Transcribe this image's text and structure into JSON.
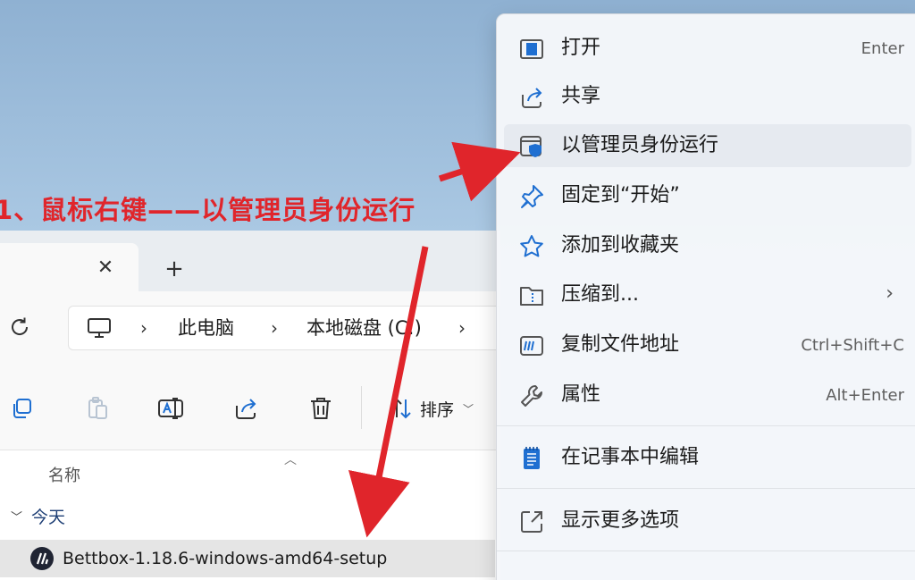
{
  "explorer": {
    "tab_close": "✕",
    "new_tab": "+",
    "breadcrumb": [
      "此电脑",
      "本地磁盘 (C:)"
    ],
    "toolbar": {
      "sort_label": "排序"
    },
    "file_list": {
      "column_name": "名称",
      "group": "今天",
      "file": "Bettbox-1.18.6-windows-amd64-setup"
    }
  },
  "context_menu": {
    "items": [
      {
        "label": "打开",
        "shortcut": "Enter"
      },
      {
        "label": "共享",
        "shortcut": ""
      },
      {
        "label": "以管理员身份运行",
        "shortcut": ""
      },
      {
        "label": "固定到“开始”",
        "shortcut": ""
      },
      {
        "label": "添加到收藏夹",
        "shortcut": ""
      },
      {
        "label": "压缩到...",
        "shortcut": ""
      },
      {
        "label": "复制文件地址",
        "shortcut": "Ctrl+Shift+C"
      },
      {
        "label": "属性",
        "shortcut": "Alt+Enter"
      },
      {
        "label": "在记事本中编辑",
        "shortcut": ""
      },
      {
        "label": "显示更多选项",
        "shortcut": ""
      }
    ]
  },
  "annotation": {
    "text": "1、鼠标右键——以管理员身份运行"
  },
  "colors": {
    "annotation_red": "#e0252b",
    "accent_blue": "#1f6fd1"
  }
}
